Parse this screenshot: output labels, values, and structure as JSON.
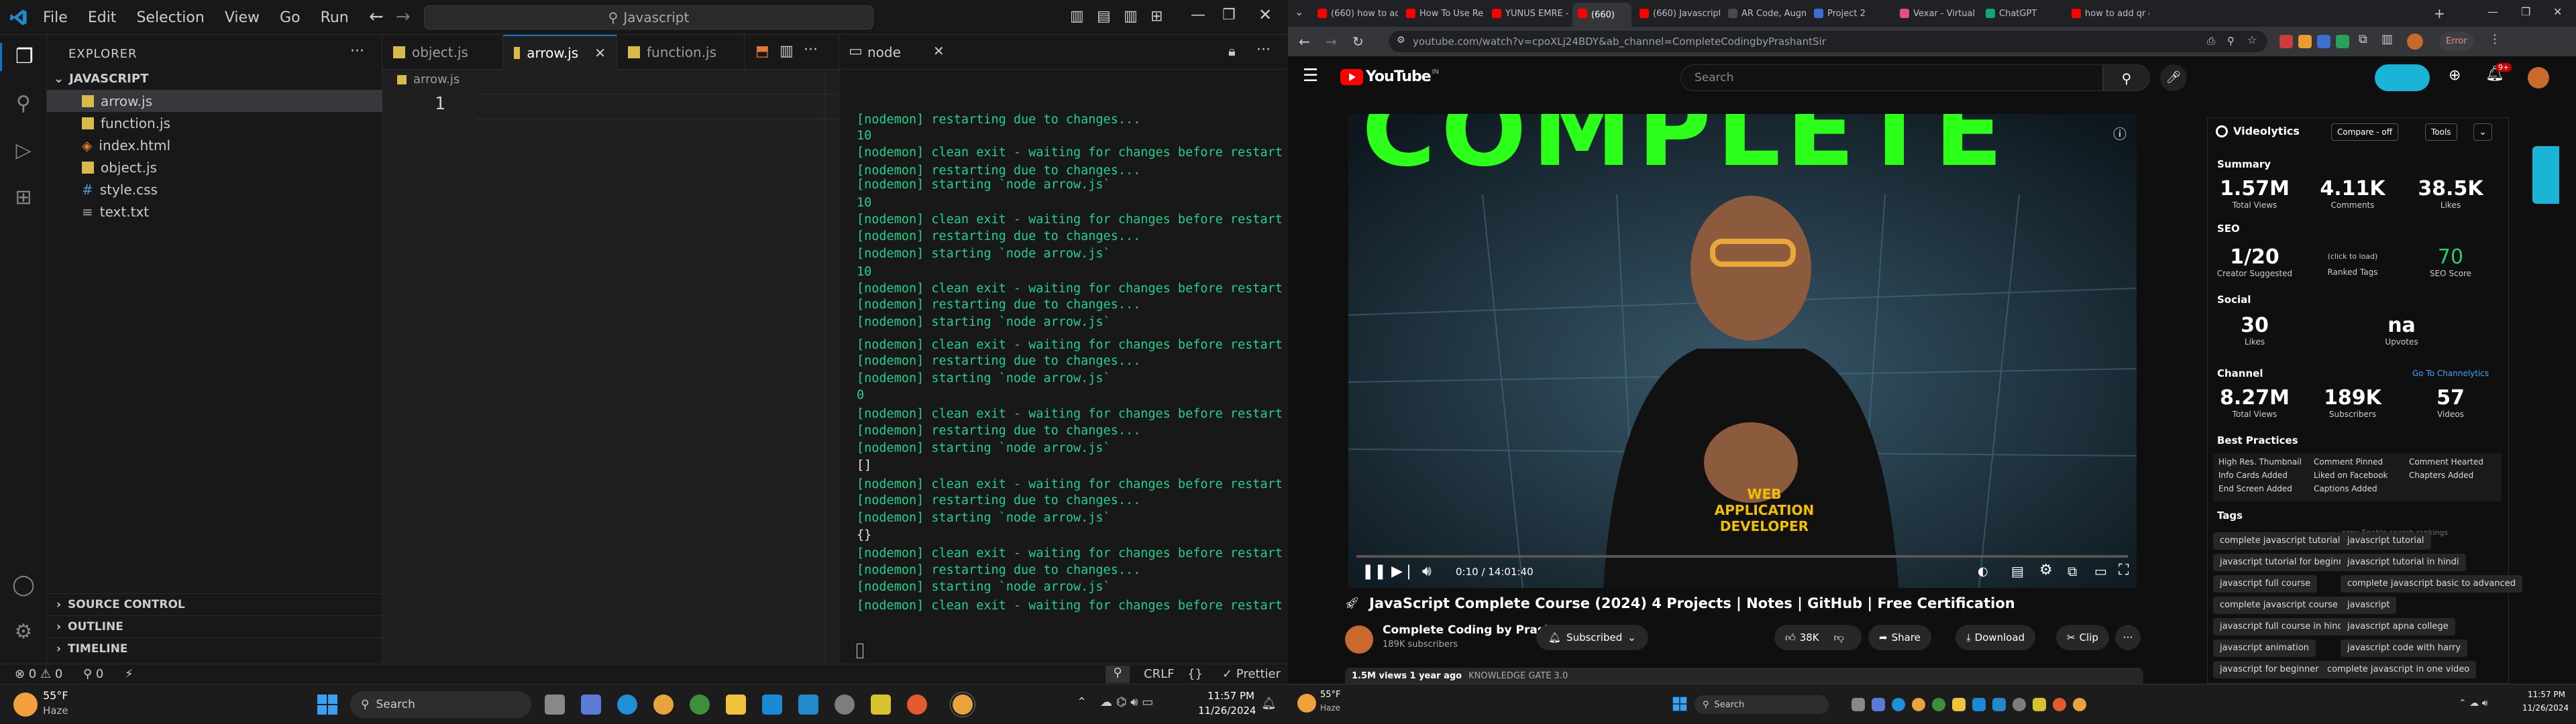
{
  "vscode": {
    "menu": [
      "File",
      "Edit",
      "Selection",
      "View",
      "Go",
      "Run",
      "···"
    ],
    "command_center": "Javascript",
    "explorer_title": "EXPLORER",
    "folder": "JAVASCRIPT",
    "files": [
      "arrow.js",
      "function.js",
      "index.html",
      "object.js",
      "style.css",
      "text.txt"
    ],
    "sections": [
      "SOURCE CONTROL",
      "OUTLINE",
      "TIMELINE"
    ],
    "tabs": [
      "object.js",
      "arrow.js",
      "function.js"
    ],
    "breadcrumb": "arrow.js",
    "line_number": "1",
    "terminal_tab": "node",
    "terminal_lines": [
      "[nodemon] restarting due to changes...",
      "10",
      "[nodemon] clean exit - waiting for changes before restart",
      "[nodemon] restarting due to changes...",
      "[nodemon] starting `node arrow.js`",
      "10",
      "[nodemon] clean exit - waiting for changes before restart",
      "[nodemon] restarting due to changes...",
      "[nodemon] starting `node arrow.js`",
      "10",
      "[nodemon] clean exit - waiting for changes before restart",
      "[nodemon] restarting due to changes...",
      "[nodemon] starting `node arrow.js`",
      "[nodemon] clean exit - waiting for changes before restart",
      "[nodemon] restarting due to changes...",
      "[nodemon] starting `node arrow.js`",
      "0",
      "[nodemon] clean exit - waiting for changes before restart",
      "[nodemon] restarting due to changes...",
      "[nodemon] starting `node arrow.js`",
      "[]",
      "[nodemon] clean exit - waiting for changes before restart",
      "[nodemon] restarting due to changes...",
      "[nodemon] starting `node arrow.js`",
      "{}",
      "[nodemon] clean exit - waiting for changes before restart",
      "[nodemon] restarting due to changes...",
      "[nodemon] starting `node arrow.js`",
      "[nodemon] clean exit - waiting for changes before restart"
    ],
    "status": {
      "problems": "⊗ 0 ⚠ 0",
      "ports": "⚲ 0",
      "eol": "CRLF",
      "lang": "{}",
      "prettier": "✓ Prettier"
    }
  },
  "taskbar_left": {
    "temp": "55°F",
    "weather": "Haze",
    "search": "Search",
    "time": "11:57 PM",
    "date": "11/26/2024"
  },
  "taskbar_right": {
    "temp": "55°F",
    "weather": "Haze",
    "search": "Search",
    "time": "11:57 PM",
    "date": "11/26/2024"
  },
  "chrome": {
    "tabs": [
      "(660) how to add",
      "How To Use Rea",
      "YUNUS EMRE - R",
      "(660)",
      "(660) Javascript",
      "AR Code, Augme",
      "Project 2",
      "Vexar - Virtual R",
      "ChatGPT",
      "how to add qr co"
    ],
    "url": "youtube.com/watch?v=cpoXLj24BDY&ab_channel=CompleteCodingbyPrashantSir",
    "error": "Error"
  },
  "youtube": {
    "logo": "YouTube",
    "region": "IN",
    "search_placeholder": "Search",
    "notif_count": "9+",
    "video_banner_text": "COMPLETE",
    "shirt_text": "WEB APPLICATION DEVELOPER",
    "time": "0:10 / 14:01:40",
    "title": "JavaScript Complete Course (2024) 4 Projects | Notes | GitHub | Free Certification",
    "channel": "Complete Coding by Prashant Sir",
    "subscribers": "189K subscribers",
    "subscribed": "Subscribed",
    "likes": "38K",
    "share": "Share",
    "download": "Download",
    "clip": "Clip",
    "views_meta": "1.5M views  1 year ago",
    "meta_link": "KNOWLEDGE GATE 3.0"
  },
  "videolytics": {
    "brand": "Videolytics",
    "compare": "Compare - off",
    "tools": "Tools",
    "summary_title": "Summary",
    "summary": [
      {
        "v": "1.57M",
        "l": "Total Views"
      },
      {
        "v": "4.11K",
        "l": "Comments"
      },
      {
        "v": "38.5K",
        "l": "Likes"
      }
    ],
    "seo_title": "SEO",
    "seo": [
      {
        "v": "1/20",
        "l": "Creator Suggested"
      },
      {
        "v": "(click to load)",
        "l": "Ranked Tags"
      },
      {
        "v": "70",
        "l": "SEO Score"
      }
    ],
    "social_title": "Social",
    "social": [
      {
        "v": "30",
        "l": "Likes"
      },
      {
        "v": "na",
        "l": "Upvotes"
      }
    ],
    "channel_title": "Channel",
    "channel_link": "Go To Channelytics",
    "channel": [
      {
        "v": "8.27M",
        "l": "Total Views"
      },
      {
        "v": "189K",
        "l": "Subscribers"
      },
      {
        "v": "57",
        "l": "Videos"
      }
    ],
    "bp_title": "Best Practices",
    "best_practices": [
      "High Res. Thumbnail",
      "Comment Pinned",
      "Comment Hearted",
      "Info Cards Added",
      "Liked on Facebook",
      "Chapters Added",
      "End Screen Added",
      "Captions Added"
    ],
    "tags_title": "Tags",
    "tags_controls": "copy    Enable search rankings",
    "tags": [
      "complete javascript tutorial",
      "javascript tutorial",
      "javascript tutorial for beginners",
      "javascript tutorial in hindi",
      "javascript full course",
      "complete javascript basic to advanced",
      "complete javascript course",
      "javascript",
      "javascript full course in hindi",
      "javascript apna college",
      "javascript animation",
      "javascript code with harry",
      "javascript for beginner",
      "complete javascript in one video"
    ]
  },
  "colors": {
    "vscode_accent": "#0078d4",
    "terminal_green": "#23d18b",
    "youtube_red": "#ff0000",
    "seo_green": "#2ecc71",
    "banner_green": "#2bff1a"
  }
}
